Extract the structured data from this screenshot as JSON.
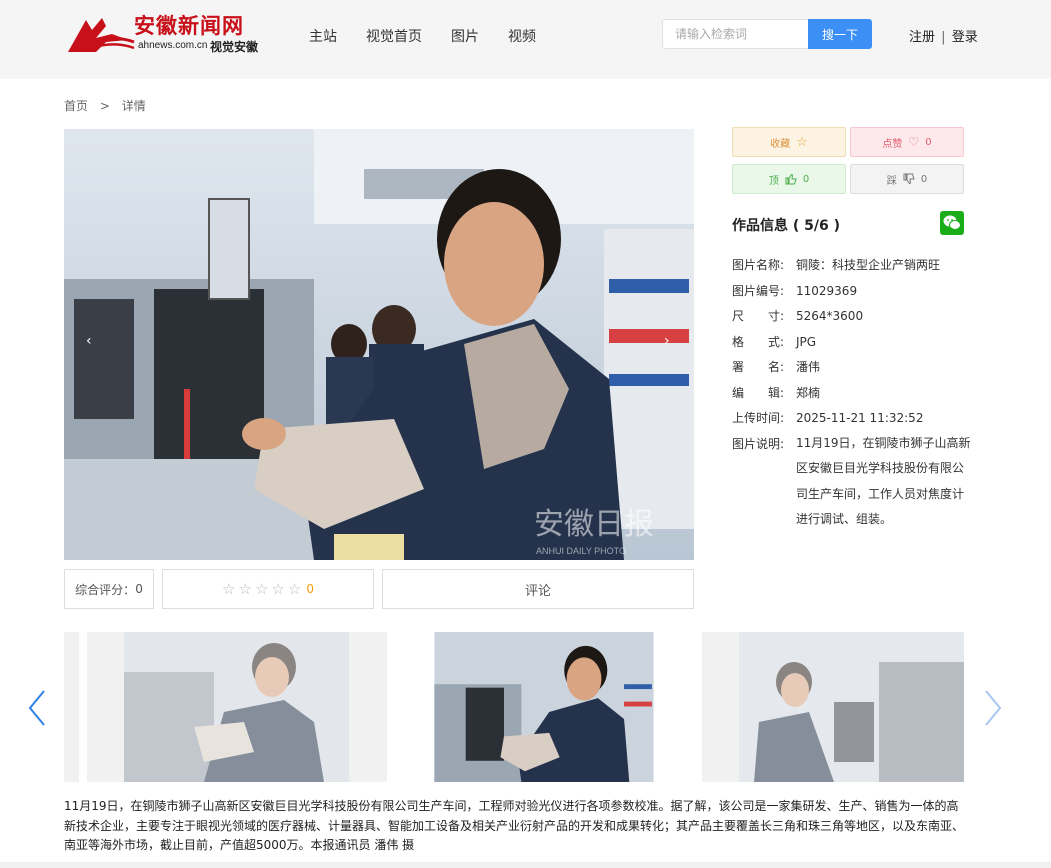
{
  "site": {
    "logo_cn": "安徽新闻网",
    "logo_domain": "ahnews.com.cn",
    "logo_sub": "视觉安徽"
  },
  "nav": [
    "主站",
    "视觉首页",
    "图片",
    "视频"
  ],
  "search": {
    "placeholder": "请输入检索词",
    "button": "搜一下"
  },
  "auth": {
    "register": "注册",
    "sep": "|",
    "login": "登录"
  },
  "breadcrumb": {
    "home": "首页",
    "arrow": ">",
    "current": "详情"
  },
  "photo": {
    "watermark_cn": "安徽日报",
    "watermark_en": "ANHUI DAILY PHOTO",
    "prev": "‹",
    "next": "›"
  },
  "rating": {
    "score_label": "综合评分：",
    "score": "0",
    "stars_count": "0",
    "stars_total": 5,
    "comment": "评论"
  },
  "actions": {
    "favorite": "收藏",
    "like": "点赞",
    "like_count": "0",
    "up": "顶",
    "up_count": "0",
    "down": "踩",
    "down_count": "0"
  },
  "info": {
    "title": "作品信息 ( 5/6 )",
    "rows": [
      {
        "label": "图片名称:",
        "value": "铜陵：科技型企业产销两旺"
      },
      {
        "label": "图片编号:",
        "value": "11029369"
      },
      {
        "label": "尺　　寸:",
        "value": "5264*3600"
      },
      {
        "label": "格　　式:",
        "value": "JPG"
      },
      {
        "label": "署　　名:",
        "value": "潘伟"
      },
      {
        "label": "编　　辑:",
        "value": "郑楠"
      },
      {
        "label": "上传时间:",
        "value": "2025-11-21 11:32:52"
      },
      {
        "label": "图片说明:",
        "value": "11月19日，在铜陵市狮子山高新区安徽巨目光学科技股份有限公司生产车间，工作人员对焦度计进行调试、组装。"
      }
    ]
  },
  "carousel": {
    "prev": "‹",
    "next": "›"
  },
  "caption": "11月19日，在铜陵市狮子山高新区安徽巨目光学科技股份有限公司生产车间，工程师对验光仪进行各项参数校准。据了解，该公司是一家集研发、生产、销售为一体的高新技术企业，主要专注于眼视光领域的医疗器械、计量器具、智能加工设备及相关产业衍射产品的开发和成果转化；其产品主要覆盖长三角和珠三角等地区，以及东南亚、南亚等海外市场，截止目前，产值超5000万。本报通讯员 潘伟 摄",
  "colors": {
    "accent": "#3b8ff5",
    "logo_red": "#c8101a",
    "wechat": "#1aad19",
    "star_count": "#f59e0b"
  }
}
